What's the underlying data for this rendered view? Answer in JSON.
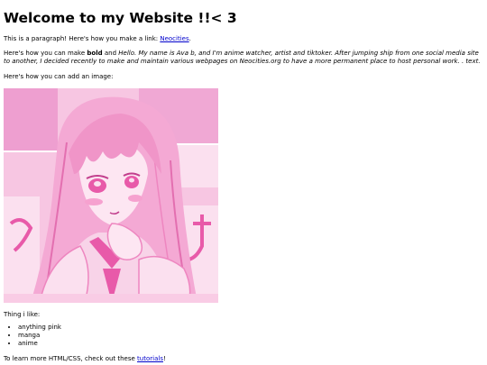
{
  "page": {
    "heading": "Welcome to my Website !!< 3",
    "link_intro": "This is a paragraph! Here's how you make a link: ",
    "link_text": "Neocities",
    "link_suffix": ".",
    "bold_intro": "Here's how you can make ",
    "bold_word": "bold",
    "bold_and": " and ",
    "italic_text": "Hello. My name is Ava b, and I'm anime watcher, artist and tiktoker. After jumping ship from one social media site to another, I decided recently to make and maintain various webpages on Neocities.org to have a more permanent place to host personal work. . text.",
    "image_intro": "Here's how you can add an image:",
    "likes_title": "Thing i like:",
    "likes": [
      "anything pink",
      "manga",
      "anime"
    ],
    "tutorial_intro": "To learn more HTML/CSS, check out these ",
    "tutorial_link": "tutorials",
    "tutorial_suffix": "!"
  },
  "image": {
    "subject": "pink anime girl illustration",
    "colors": {
      "pink_dark": "#e85aa9",
      "pink_mid": "#f28cc7",
      "pink_light": "#f9cce5",
      "white": "#fff5fb"
    }
  }
}
